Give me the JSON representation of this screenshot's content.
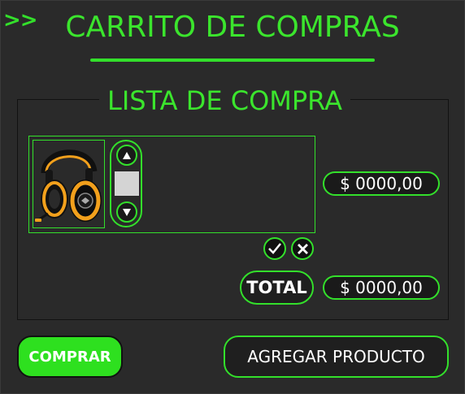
{
  "header": {
    "nav_glyph": ">>",
    "title": "CARRITO DE COMPRAS"
  },
  "list": {
    "legend": "LISTA DE COMPRA",
    "items": [
      {
        "image": "headset-product-image",
        "quantity": "",
        "price": "$ 0000,00"
      }
    ]
  },
  "summary": {
    "total_label": "TOTAL",
    "total_value": "$ 0000,00"
  },
  "actions": {
    "buy_label": "COMPRAR",
    "add_label": "AGREGAR PRODUCTO"
  },
  "icons": {
    "increase": "triangle-up-icon",
    "decrease": "triangle-down-icon",
    "confirm": "check-icon",
    "remove": "close-icon"
  },
  "colors": {
    "background": "#2a2a2a",
    "accent": "#33e02b",
    "control_fill": "#1a1a1a",
    "buy_button": "#2ee01f"
  }
}
